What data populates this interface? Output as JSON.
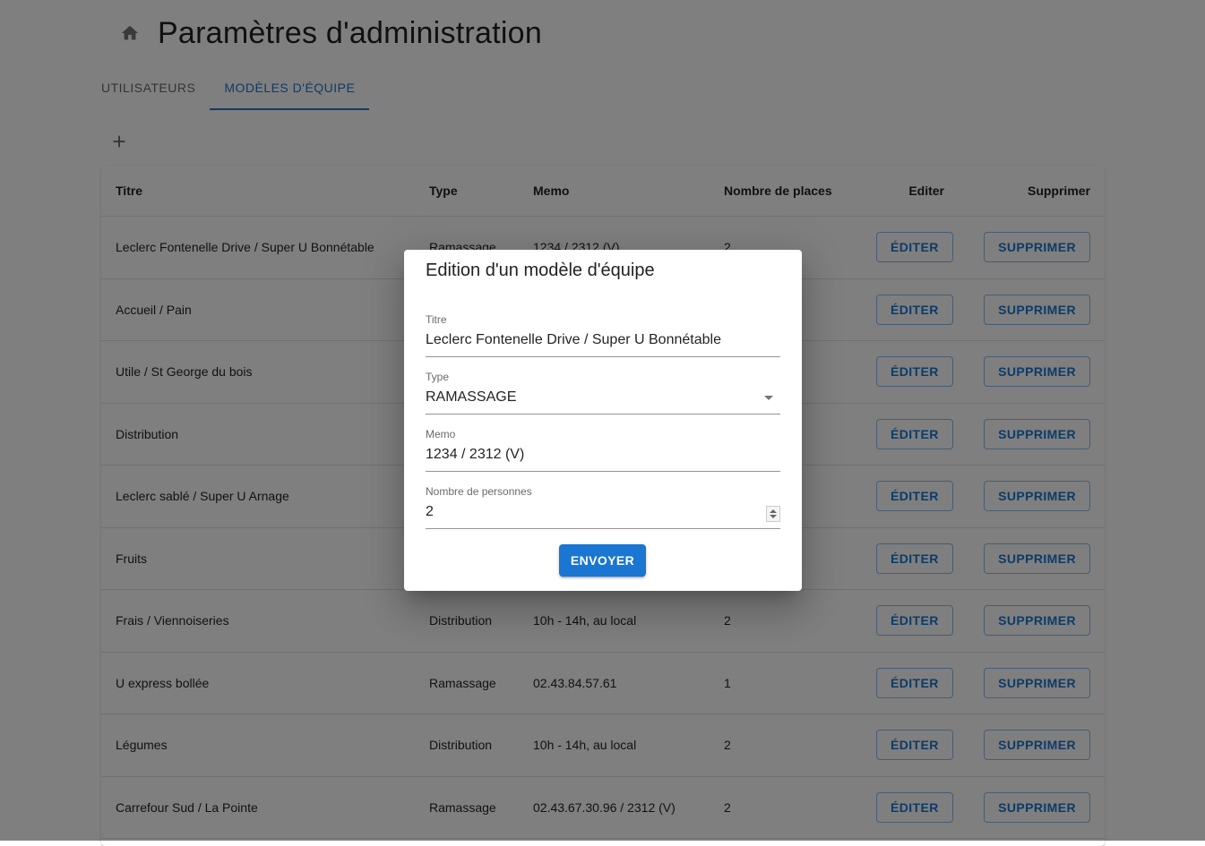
{
  "header": {
    "title": "Paramètres d'administration"
  },
  "tabs": [
    {
      "label": "UTILISATEURS",
      "active": false
    },
    {
      "label": "MODÈLES D'ÉQUIPE",
      "active": true
    }
  ],
  "table": {
    "columns": [
      "Titre",
      "Type",
      "Memo",
      "Nombre de places",
      "Editer",
      "Supprimer"
    ],
    "edit_label": "ÉDITER",
    "delete_label": "SUPPRIMER",
    "rows": [
      {
        "titre": "Leclerc Fontenelle Drive / Super U Bonnétable",
        "type": "Ramassage",
        "memo": "1234 / 2312 (V)",
        "places": "2"
      },
      {
        "titre": "Accueil / Pain",
        "type": "",
        "memo": "",
        "places": ""
      },
      {
        "titre": "Utile / St George du bois",
        "type": "",
        "memo": "",
        "places": ""
      },
      {
        "titre": "Distribution",
        "type": "",
        "memo": "",
        "places": ""
      },
      {
        "titre": "Leclerc sablé / Super U Arnage",
        "type": "",
        "memo": "",
        "places": ""
      },
      {
        "titre": "Fruits",
        "type": "",
        "memo": "",
        "places": ""
      },
      {
        "titre": "Frais / Viennoiseries",
        "type": "Distribution",
        "memo": "10h - 14h, au local",
        "places": "2"
      },
      {
        "titre": "U express bollée",
        "type": "Ramassage",
        "memo": "02.43.84.57.61",
        "places": "1"
      },
      {
        "titre": "Légumes",
        "type": "Distribution",
        "memo": "10h - 14h, au local",
        "places": "2"
      },
      {
        "titre": "Carrefour Sud / La Pointe",
        "type": "Ramassage",
        "memo": "02.43.67.30.96 / 2312 (V)",
        "places": "2"
      }
    ]
  },
  "dialog": {
    "title": "Edition d'un modèle d'équipe",
    "fields": {
      "titre": {
        "label": "Titre",
        "value": "Leclerc Fontenelle Drive / Super U Bonnétable"
      },
      "type": {
        "label": "Type",
        "value": "RAMASSAGE"
      },
      "memo": {
        "label": "Memo",
        "value": "1234 / 2312 (V)"
      },
      "personnes": {
        "label": "Nombre de personnes",
        "value": "2"
      }
    },
    "submit_label": "ENVOYER"
  },
  "colors": {
    "primary": "#1976d2",
    "overlay": "rgba(0,0,0,0.5)"
  }
}
